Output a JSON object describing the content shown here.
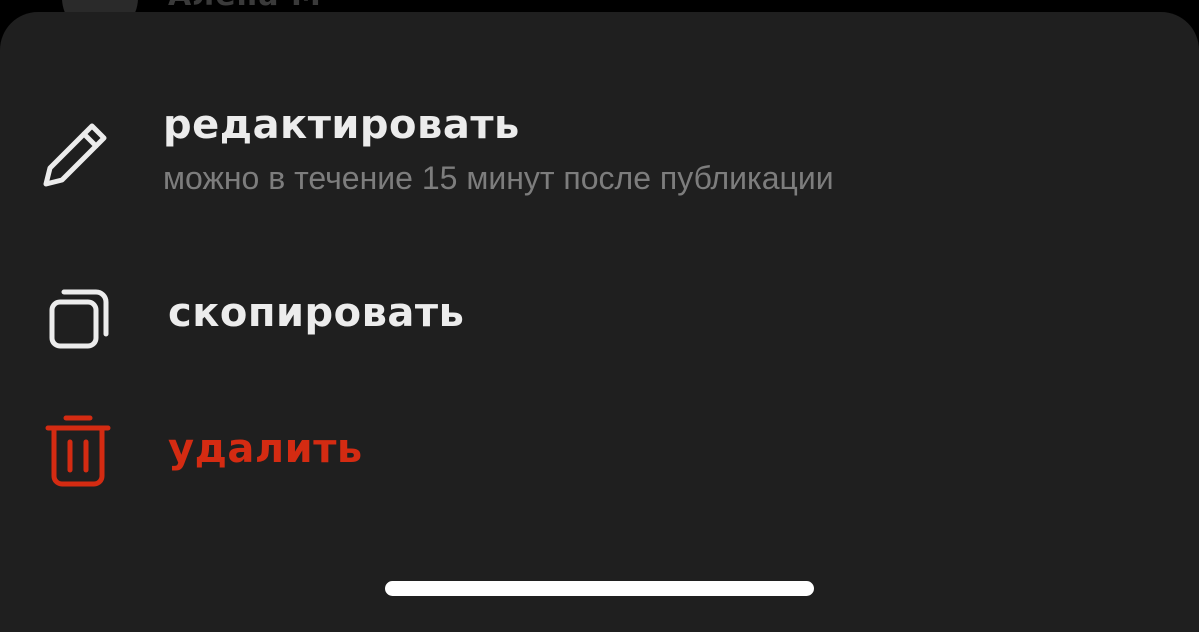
{
  "background_peek": {
    "name": "Алёна М"
  },
  "menu": {
    "items": [
      {
        "id": "edit",
        "icon": "pencil-icon",
        "label": "редактировать",
        "sublabel": "можно в течение 15 минут после публикации",
        "color": "#ececec"
      },
      {
        "id": "copy",
        "icon": "copy-icon",
        "label": "скопировать",
        "color": "#ececec"
      },
      {
        "id": "delete",
        "icon": "trash-icon",
        "label": "удалить",
        "color": "#d42b12"
      }
    ]
  },
  "colors": {
    "sheet_background": "#1f1f1f",
    "primary_text": "#ececec",
    "secondary_text": "#7d7d7d",
    "destructive": "#d42b12",
    "home_indicator": "#ffffff"
  }
}
